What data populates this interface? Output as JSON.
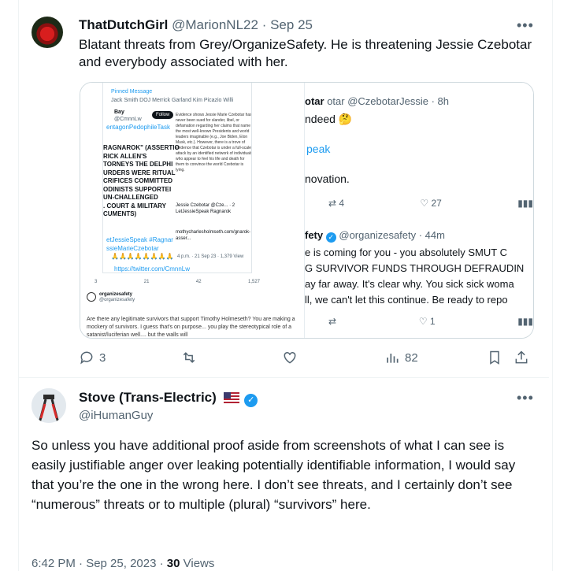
{
  "tweet1": {
    "display_name": "ThatDutchGirl",
    "handle": "@MarionNL22",
    "separator": "·",
    "date": "Sep 25",
    "text": "Blatant threats from Grey/OrganizeSafety. He is threatening Jessie Czebotar and everybody associated with her.",
    "media": {
      "left": {
        "pinned_label": "Pinned Message",
        "pinned_names": "Jack Smith  DOJ  Merrick Garland  Kim Picazio  Willi",
        "author": "Bay",
        "author_handle": "@CmnnLw",
        "follow_label": "Follow",
        "quote_text": "Evidence shows Jessie Marie Czebotar has never been sued for slander, libel, or defamation regarding her claims that name the most well-known Presidents and world leaders imaginable (e.g., Joe Biden, Elon Musk, etc.). However, there is a trove of evidence that Czebotar is under a full-scale attack by an identified network of individuals who appear to feel his life and death for them to convince the world Czebotar is lying.",
        "hashtag_top": "entagonPedophileTask",
        "caps_text": "RAGNAROK\" (ASSERTIO\nRICK ALLEN'S\nTORNEYS THE DELPHI\nURDERS WERE RITUAL\nCRIFICES COMMITTED\nODINISTS SUPPORTEI\nUN-CHALLENGED\n. COURT & MILITARY\nCUMENTS)",
        "jessie_reply": "Jessie Czebotar @Cze... · 2 LetJessieSpeak Ragnarok",
        "link_preview": "mothycharlesholmseth.com/gnarok-asser...",
        "hashtags": "etJessieSpeak #Ragnar\nssieMarieCzebotar",
        "emoji_row": "🙏🙏🙏🙏🙏🙏🙏🙏",
        "link": "https://twitter.com/CmnnLw",
        "timestamp": "4 p.m. · 21 Sep 23 · 1,379 View",
        "reply_count": "3",
        "retweet_count": "21",
        "like_count": "42",
        "view_count": "1,527",
        "org_name": "organizesafety",
        "org_handle": "@organizesafety",
        "org_text": "Are there any legitimate survivors that support Timothy Holmeseth? You are making a mockery of survivors. I guess that's on purpose... you play the stereotypical role of a satanist/luciferian well.... but the walls will"
      },
      "right": {
        "top_handle_partial": "otar @CzebotarJessie · 8h",
        "line1": "ndeed 🤔",
        "line2": "peak",
        "line3": "novation.",
        "actions_top": {
          "retweets": "4",
          "likes": "27"
        },
        "org_row": "fety",
        "org_handle": "@organizesafety · 44m",
        "body": [
          "e is coming for you - you absolutely SMUT C",
          "G SURVIVOR FUNDS THROUGH DEFRAUDIN",
          "ay far away. It's clear why. You sick sick woma",
          "ll, we can't let this continue.  Be ready to repo"
        ],
        "actions_bottom": {
          "likes": "1"
        }
      }
    },
    "actions": {
      "replies": "3",
      "views": "82"
    }
  },
  "tweet2": {
    "display_name": "Stove (Trans-Electric)",
    "handle": "@iHumanGuy",
    "text": "So unless you have additional proof aside from screenshots of what I can see is easily justifiable anger over leaking potentially identifiable information, I would say that you’re the one in the wrong here. I don’t see threats, and I certainly don’t see “numerous” threats or to multiple (plural) “survivors” here.",
    "time": "6:42 PM · Sep 25, 2023 · ",
    "views_count": "30",
    "views_label": " Views"
  },
  "colors": {
    "accent": "#1d9bf0",
    "muted": "#536471",
    "text": "#0f1419",
    "border": "#eff3f4"
  }
}
